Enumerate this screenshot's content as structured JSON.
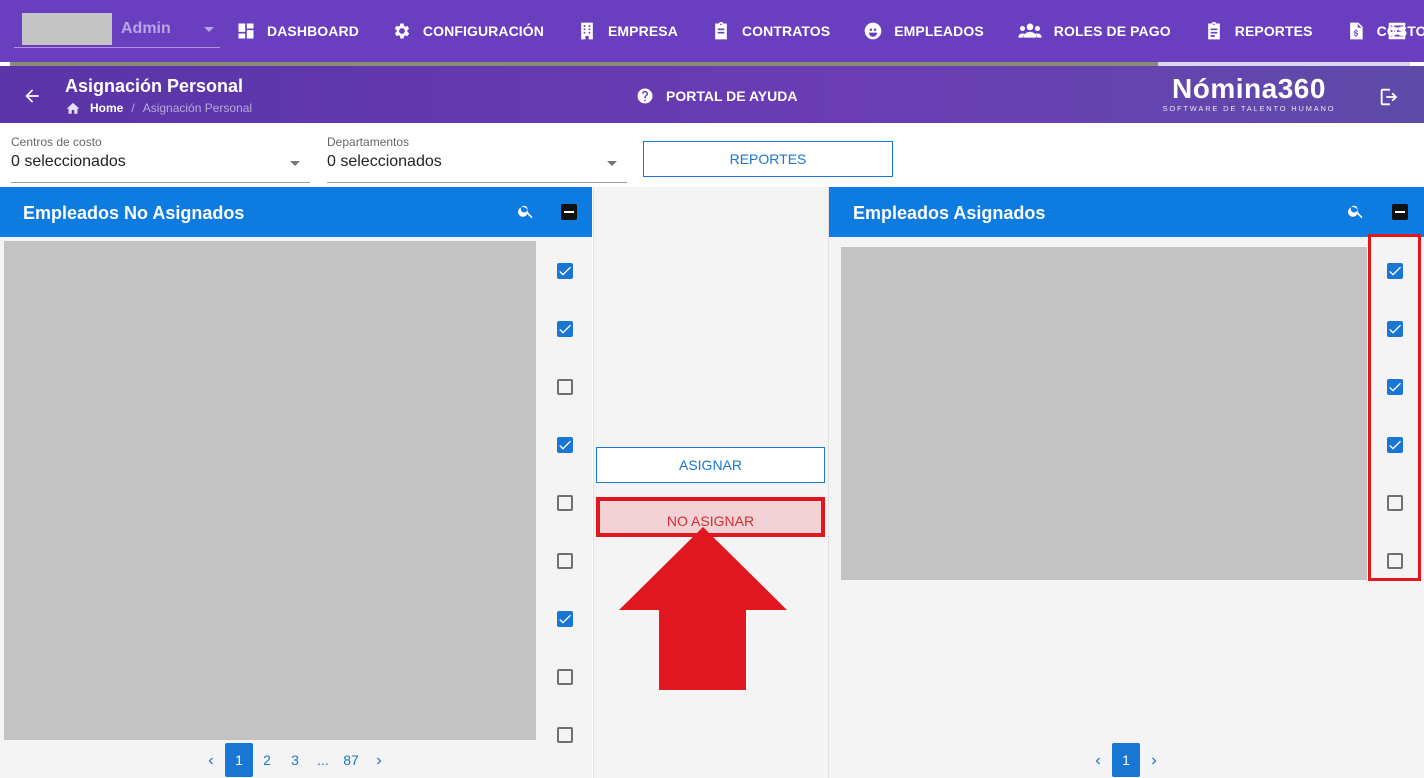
{
  "topnav": {
    "user_name": "Admin",
    "items": [
      {
        "label": "DASHBOARD",
        "icon": "dashboard-icon"
      },
      {
        "label": "CONFIGURACIÓN",
        "icon": "gear-icon"
      },
      {
        "label": "EMPRESA",
        "icon": "building-icon"
      },
      {
        "label": "CONTRATOS",
        "icon": "clipboard-icon"
      },
      {
        "label": "EMPLEADOS",
        "icon": "face-icon"
      },
      {
        "label": "ROLES DE PAGO",
        "icon": "group-icon"
      },
      {
        "label": "REPORTES",
        "icon": "clipboard-list-icon"
      },
      {
        "label": "COSTOS",
        "icon": "document-dollar-icon"
      }
    ],
    "more_icon": "list-icon"
  },
  "header": {
    "title": "Asignación Personal",
    "breadcrumb_home": "Home",
    "breadcrumb_separator": "/",
    "breadcrumb_current": "Asignación Personal",
    "help_label": "PORTAL DE AYUDA",
    "brand_name": "Nómina360",
    "brand_sub": "SOFTWARE DE TALENTO HUMANO"
  },
  "filters": {
    "cost_centers": {
      "label": "Centros de costo",
      "value": "0 seleccionados"
    },
    "departments": {
      "label": "Departamentos",
      "value": "0 seleccionados"
    },
    "reports_button": "REPORTES"
  },
  "left_panel": {
    "title": "Empleados No Asignados",
    "checkboxes": [
      true,
      true,
      false,
      true,
      false,
      false,
      true,
      false,
      false
    ],
    "pagination": {
      "pages": [
        "1",
        "2",
        "3",
        "...",
        "87"
      ],
      "active": "1"
    }
  },
  "middle": {
    "assign_label": "ASIGNAR",
    "unassign_label": "NO ASIGNAR"
  },
  "right_panel": {
    "title": "Empleados Asignados",
    "checkboxes": [
      true,
      true,
      true,
      true,
      false,
      false
    ],
    "pagination": {
      "pages": [
        "1"
      ],
      "active": "1"
    }
  },
  "colors": {
    "nav_bg": "#6a3fbf",
    "panel_header": "#0d7be0",
    "accent": "#1976d2",
    "highlight": "#e0171f"
  }
}
